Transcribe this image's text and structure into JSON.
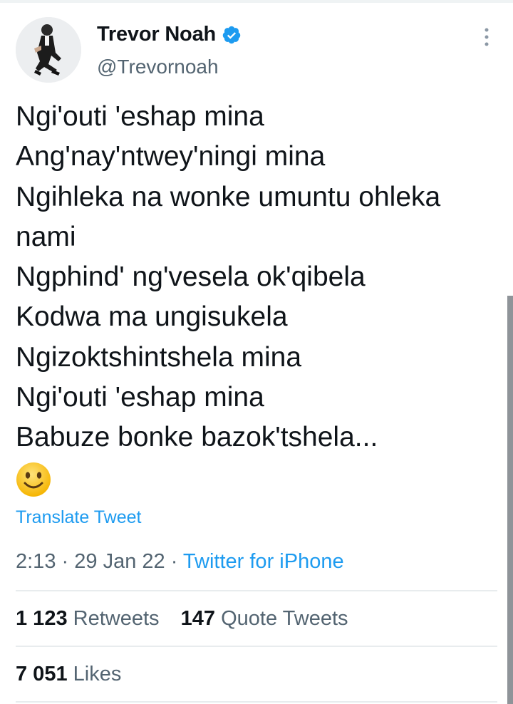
{
  "author": {
    "name": "Trevor Noah",
    "handle": "@Trevornoah"
  },
  "icons": {
    "verified": "verified-badge-icon",
    "more": "more-vertical-icon",
    "emoji": "slightly-smiling-face-emoji"
  },
  "tweet": {
    "lines": [
      "Ngi'outi 'eshap mina",
      "Ang'nay'ntwey'ningi mina",
      "Ngihleka na wonke umuntu ohleka",
      "nami",
      "Ngphind' ng'vesela ok'qibela",
      "Kodwa ma ungisukela",
      "Ngizoktshintshela mina",
      "Ngi'outi 'eshap mina",
      "Babuze bonke bazok'tshela..."
    ],
    "translate_label": "Translate Tweet",
    "time": "2:13",
    "date": "29 Jan 22",
    "source": "Twitter for iPhone",
    "separator": "·"
  },
  "stats": {
    "retweets_count": "1 123",
    "retweets_label": "Retweets",
    "quotes_count": "147",
    "quotes_label": "Quote Tweets",
    "likes_count": "7 051",
    "likes_label": "Likes"
  },
  "colors": {
    "link": "#1d9bf0",
    "secondary_text": "#536471",
    "primary_text": "#0f1419",
    "divider": "#e8ecee"
  }
}
